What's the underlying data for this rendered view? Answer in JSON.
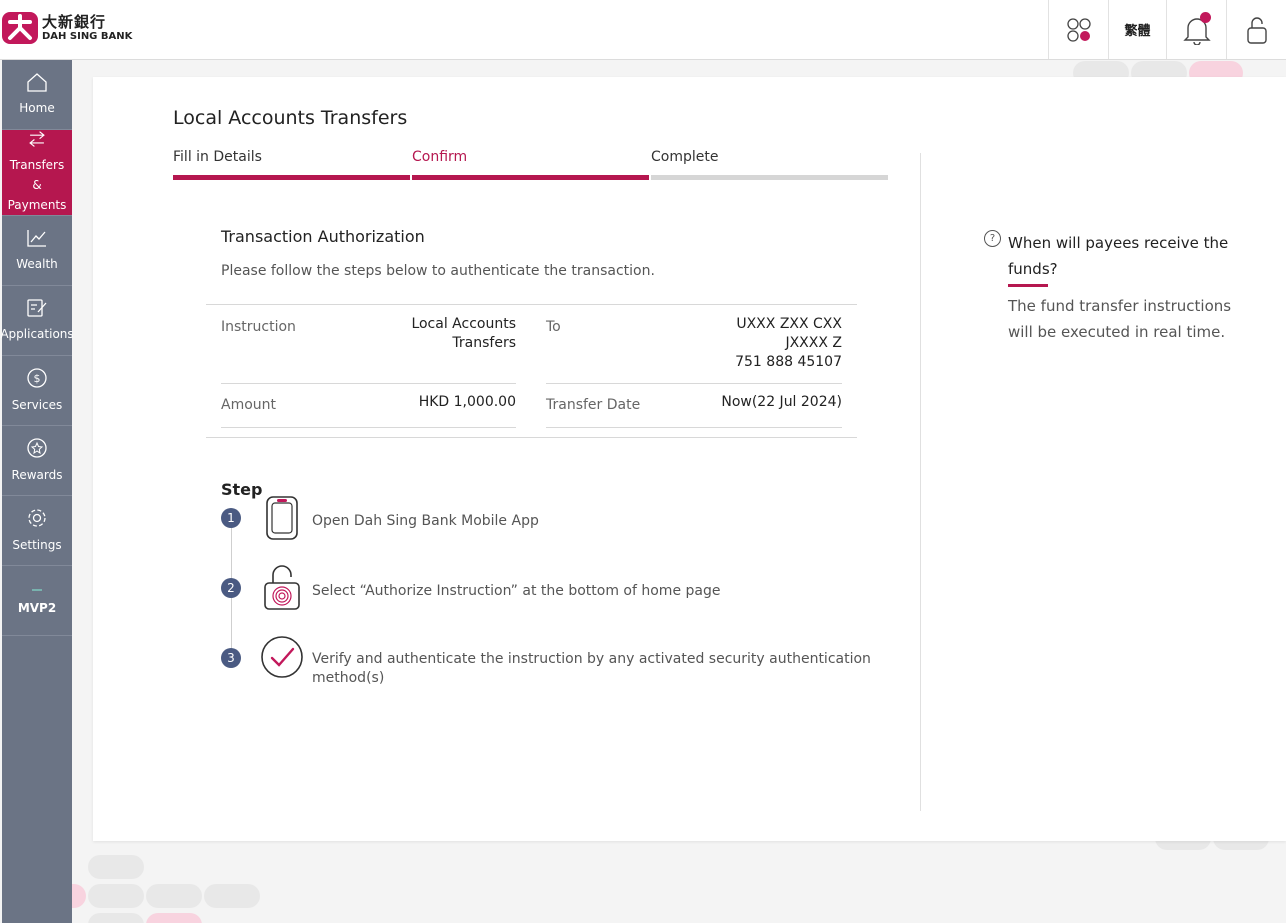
{
  "brand": {
    "name_cn": "大新銀行",
    "name_en": "DAH SING BANK",
    "accent": "#b5174f"
  },
  "topbar": {
    "language_label": "繁體"
  },
  "sidebar": {
    "items": [
      {
        "label": "Home"
      },
      {
        "label": "Transfers & Payments"
      },
      {
        "label": "Wealth"
      },
      {
        "label": "Applications"
      },
      {
        "label": "Services"
      },
      {
        "label": "Rewards"
      },
      {
        "label": "Settings"
      },
      {
        "label": "MVP2"
      }
    ]
  },
  "page": {
    "title": "Local Accounts Transfers",
    "steps": [
      "Fill in Details",
      "Confirm",
      "Complete"
    ],
    "current_step": 2
  },
  "auth": {
    "title": "Transaction Authorization",
    "subtitle": "Please follow the steps below to authenticate the transaction."
  },
  "details": {
    "instruction_label": "Instruction",
    "instruction_value_line1": "Local Accounts",
    "instruction_value_line2": "Transfers",
    "to_label": "To",
    "to_line1": "UXXX ZXX CXX",
    "to_line2": "JXXXX Z",
    "to_line3": "751 888 45107",
    "amount_label": "Amount",
    "amount_value": "HKD 1,000.00",
    "date_label": "Transfer Date",
    "date_value": "Now(22 Jul 2024)"
  },
  "guide": {
    "heading": "Step",
    "steps": [
      {
        "num": "1",
        "text": "Open Dah Sing Bank Mobile App"
      },
      {
        "num": "2",
        "text": "Select “Authorize Instruction” at the bottom of home page"
      },
      {
        "num": "3",
        "text": "Verify and authenticate the instruction by any activated security authentication method(s)"
      }
    ]
  },
  "faq": {
    "question": "When will payees receive the funds?",
    "answer": "The fund transfer instructions will be executed in real time."
  }
}
